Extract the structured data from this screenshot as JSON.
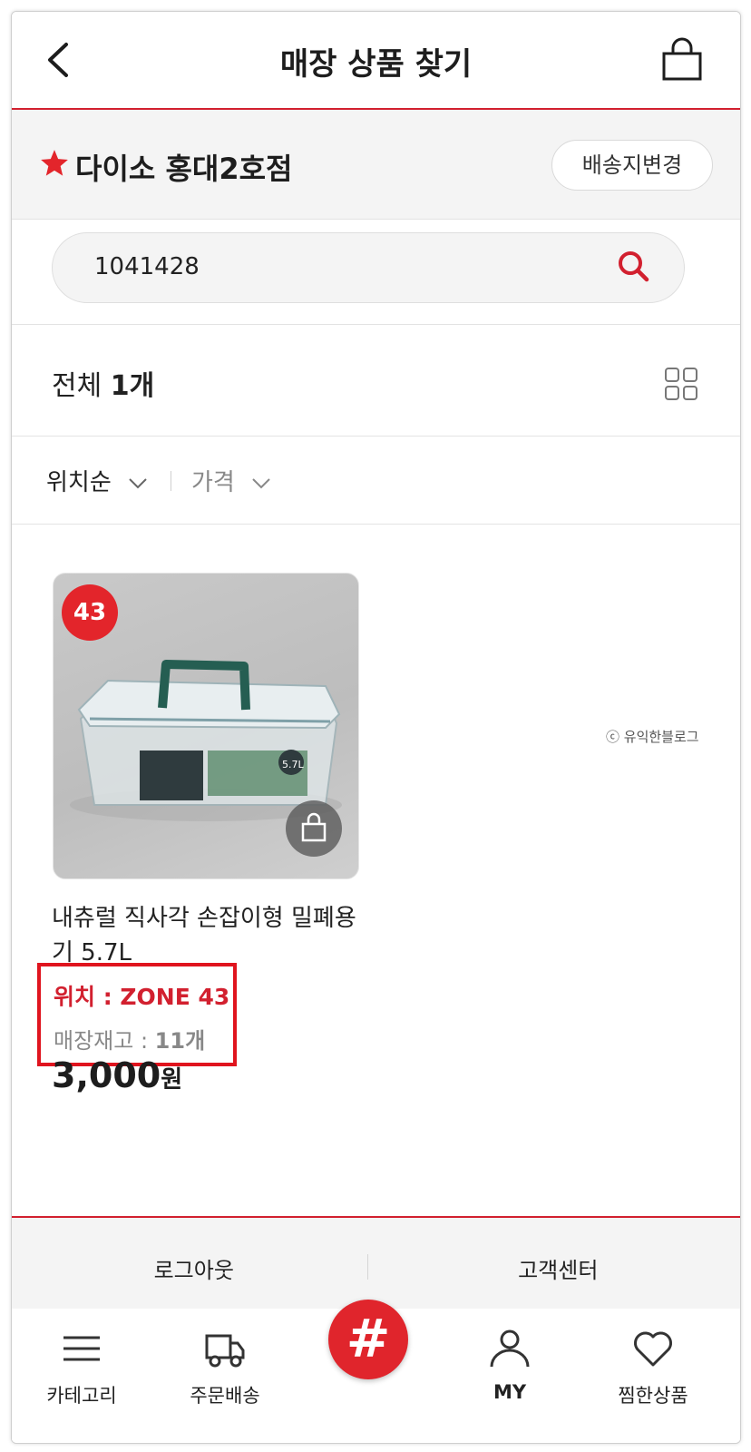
{
  "header": {
    "title": "매장 상품 찾기",
    "back_icon": "chevron-left-icon",
    "cart_icon": "shopping-bag-icon"
  },
  "store": {
    "name": "다이소 홍대2호점",
    "change_button": "배송지변경",
    "accent": "#e3252b"
  },
  "search": {
    "value": "1041428"
  },
  "results": {
    "label": "전체 ",
    "count": "1개"
  },
  "sort": {
    "position": "위치순",
    "price": "가격"
  },
  "product": {
    "zone_badge": "43",
    "name": "내츄럴 직사각 손잡이형 밀폐용기 5.7L",
    "location": "위치 : ZONE 43",
    "stock_label": "매장재고 : ",
    "stock_value": "11개",
    "price_value": "3,000",
    "price_unit": "원"
  },
  "watermark": "ⓒ 유익한블로그",
  "footer": {
    "logout": "로그아웃",
    "support": "고객센터"
  },
  "nav": {
    "category": "카테고리",
    "delivery": "주문배송",
    "hash": "#",
    "my": "MY",
    "wishlist": "찜한상품"
  }
}
